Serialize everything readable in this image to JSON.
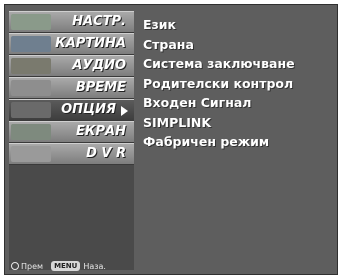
{
  "sidebar": {
    "items": [
      {
        "label": "НАСТР.",
        "thumb_color": "#8a9a8a"
      },
      {
        "label": "КАРТИНА",
        "thumb_color": "#6f7f8f"
      },
      {
        "label": "АУДИО",
        "thumb_color": "#7a7a6e"
      },
      {
        "label": "ВРЕМЕ",
        "thumb_color": "#8e8e8e"
      },
      {
        "label": "ОПЦИЯ",
        "thumb_color": "#6a6a6a",
        "selected": true
      },
      {
        "label": "ЕКРАН",
        "thumb_color": "#7e8a7e"
      },
      {
        "label": "D V R",
        "thumb_color": "#9a9a9a"
      }
    ]
  },
  "options": [
    "Език",
    "Страна",
    "Система заключване",
    "Родителски контрол",
    "Входен Сигнал",
    "SIMPLINK",
    "Фабричен режим"
  ],
  "footer": {
    "move_label": "Прем",
    "menu_key": "MENU",
    "back_label": "Наза."
  }
}
